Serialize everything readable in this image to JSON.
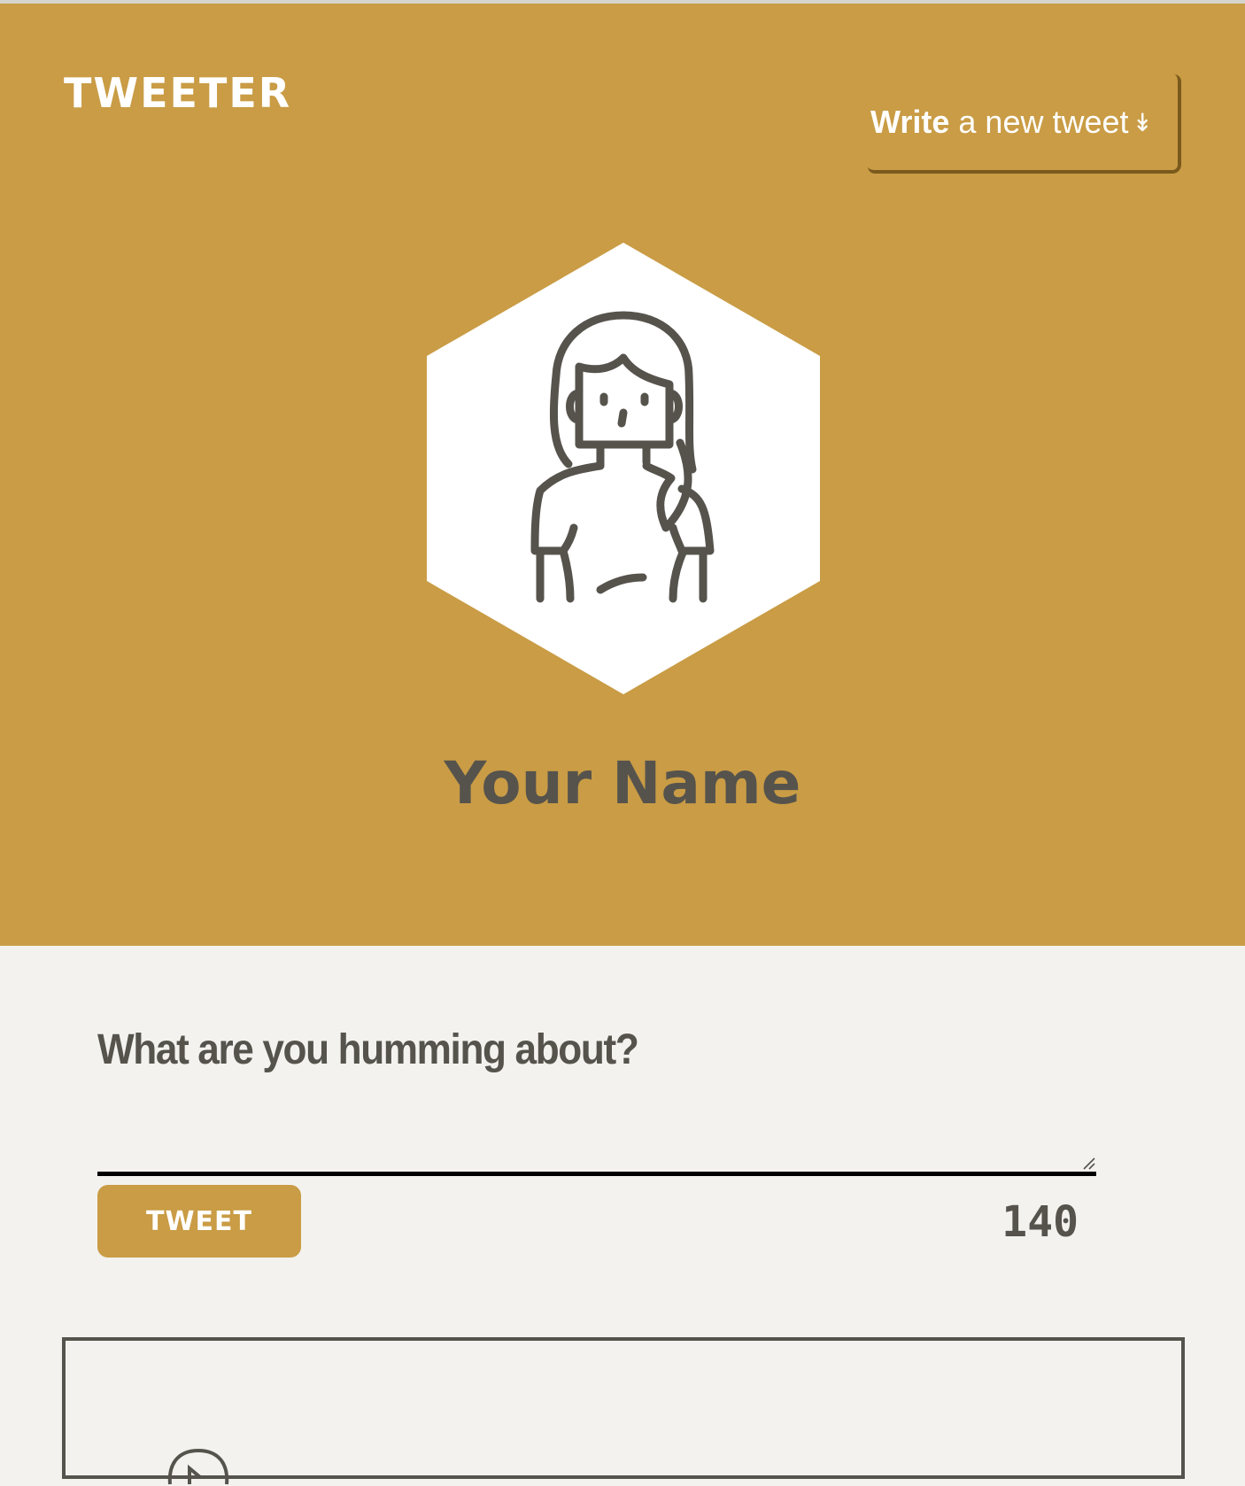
{
  "header": {
    "brand": "TWEETER",
    "write_button": {
      "bold": "Write",
      "rest": "a new tweet",
      "arrow": "↡"
    }
  },
  "profile": {
    "name": "Your Name",
    "avatar_icon": "woman-avatar-icon"
  },
  "composer": {
    "prompt": "What are you humming about?",
    "textarea_value": "",
    "tweet_button_label": "TWEET",
    "char_counter": "140"
  },
  "colors": {
    "accent": "#c99c45",
    "text_dark": "#56534d",
    "background": "#f3f2ee"
  }
}
